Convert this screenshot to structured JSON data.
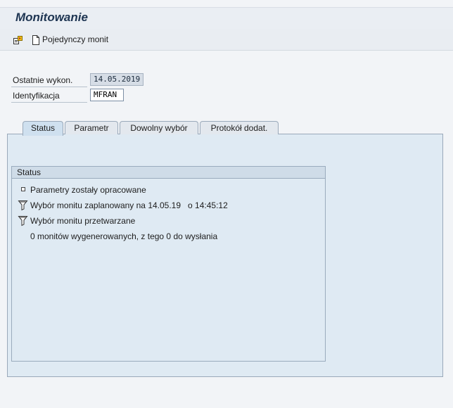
{
  "title": "Monitowanie",
  "toolbar": {
    "single_reminder_label": "Pojedynczy monit",
    "icons": [
      "execute-icon",
      "document-icon"
    ]
  },
  "form": {
    "last_run_label": "Ostatnie wykon.",
    "last_run_value": "14.05.2019",
    "identification_label": "Identyfikacja",
    "identification_value": "MFRAN"
  },
  "tabs": [
    {
      "label": "Status",
      "active": true
    },
    {
      "label": "Parametr",
      "active": false
    },
    {
      "label": "Dowolny wybór",
      "active": false
    },
    {
      "label": "Protokół dodat.",
      "active": false
    }
  ],
  "status_group": {
    "header": "Status",
    "lines": [
      {
        "icon": "square-bullet-icon",
        "text": "Parametry zostały opracowane"
      },
      {
        "icon": "funnel-icon",
        "text": "Wybór monitu zaplanowany na 14.05.19   o 14:45:12"
      },
      {
        "icon": "funnel-icon",
        "text": "Wybór monitu przetwarzane"
      },
      {
        "icon": "",
        "text": "0 monitów wygenerowanych, z tego 0 do wysłania"
      }
    ]
  },
  "colors": {
    "title": "#1e3552",
    "panel_bg": "#dfeaf3",
    "active_tab": "#cfe0ef",
    "border": "#9aa9ba"
  }
}
